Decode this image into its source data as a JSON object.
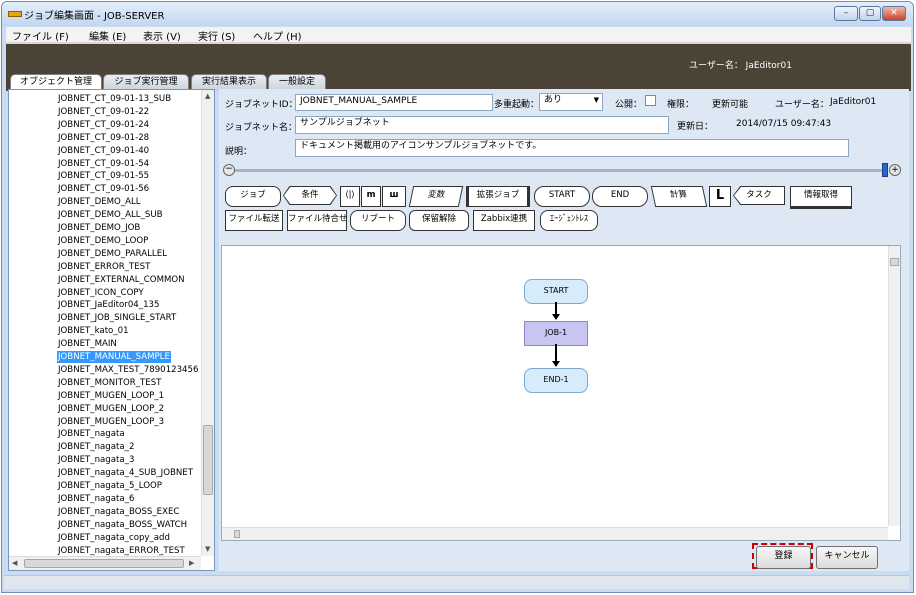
{
  "window": {
    "title": "ジョブ編集画面 - JOB-SERVER",
    "controls": {
      "minimize": "–",
      "maximize": "▢",
      "close": "✕"
    }
  },
  "menu": [
    {
      "label": "ファイル (F)"
    },
    {
      "label": "編集 (E)"
    },
    {
      "label": "表示 (V)"
    },
    {
      "label": "実行 (S)"
    },
    {
      "label": "ヘルプ (H)"
    }
  ],
  "header": {
    "user_info": "ユーザー名： JaEditor01"
  },
  "tabs": [
    {
      "label": "オブジェクト管理",
      "active": true
    },
    {
      "label": "ジョブ実行管理",
      "active": false
    },
    {
      "label": "実行結果表示",
      "active": false
    },
    {
      "label": "一般設定",
      "active": false
    }
  ],
  "tree": {
    "items": [
      "JOBNET_CT_09-01-13_SUB",
      "JOBNET_CT_09-01-22",
      "JOBNET_CT_09-01-24",
      "JOBNET_CT_09-01-28",
      "JOBNET_CT_09-01-40",
      "JOBNET_CT_09-01-54",
      "JOBNET_CT_09-01-55",
      "JOBNET_CT_09-01-56",
      "JOBNET_DEMO_ALL",
      "JOBNET_DEMO_ALL_SUB",
      "JOBNET_DEMO_JOB",
      "JOBNET_DEMO_LOOP",
      "JOBNET_DEMO_PARALLEL",
      "JOBNET_ERROR_TEST",
      "JOBNET_EXTERNAL_COMMON",
      "JOBNET_ICON_COPY",
      "JOBNET_JaEditor04_135",
      "JOBNET_JOB_SINGLE_START",
      "JOBNET_kato_01",
      "JOBNET_MAIN",
      "JOBNET_MANUAL_SAMPLE",
      "JOBNET_MAX_TEST_7890123456",
      "JOBNET_MONITOR_TEST",
      "JOBNET_MUGEN_LOOP_1",
      "JOBNET_MUGEN_LOOP_2",
      "JOBNET_MUGEN_LOOP_3",
      "JOBNET_nagata",
      "JOBNET_nagata_2",
      "JOBNET_nagata_3",
      "JOBNET_nagata_4_SUB_JOBNET",
      "JOBNET_nagata_5_LOOP",
      "JOBNET_nagata_6",
      "JOBNET_nagata_BOSS_EXEC",
      "JOBNET_nagata_BOSS_WATCH",
      "JOBNET_nagata_copy_add",
      "JOBNET_nagata_ERROR_TEST"
    ],
    "selected_index": 20
  },
  "form": {
    "jobnet_id_label": "ジョブネットID：",
    "jobnet_id_value": "JOBNET_MANUAL_SAMPLE",
    "multi_start_label": "多重起動：",
    "multi_start_value": "あり",
    "public_label": "公開：",
    "permission_label": "権限：",
    "permission_value": "更新可能",
    "username_label": "ユーザー名：",
    "username_value": "JaEditor01",
    "jobnet_name_label": "ジョブネット名：",
    "jobnet_name_value": "サンプルジョブネット",
    "updated_label": "更新日：",
    "updated_value": "2014/07/15 09:47:43",
    "description_label": "説明：",
    "description_value": "ドキュメント掲載用のアイコンサンプルジョブネットです。"
  },
  "icons_row1": [
    "ジョブ",
    "条件",
    "⟨|⟩",
    "m",
    "ш",
    "変数",
    "拡張ジョブ",
    "START",
    "END",
    "計算",
    "L",
    "タスク",
    "情報取得"
  ],
  "icons_row2": [
    "ファイル転送",
    "ファイル待合せ",
    "リブート",
    "保留解除",
    "Zabbix連携",
    "ｴｰｼﾞｪﾝﾄﾚｽ"
  ],
  "flow_nodes": [
    "START",
    "JOB-1",
    "END-1"
  ],
  "buttons": {
    "register": "登録",
    "cancel": "キャンセル"
  },
  "colors": {
    "accent_dark": "#4b4436",
    "panel_bg": "#dde8f4",
    "selection": "#3399ff",
    "job_node": "#c9c5f3",
    "start_end_node": "#d6ecfb",
    "focus_outline": "#cc0000"
  }
}
